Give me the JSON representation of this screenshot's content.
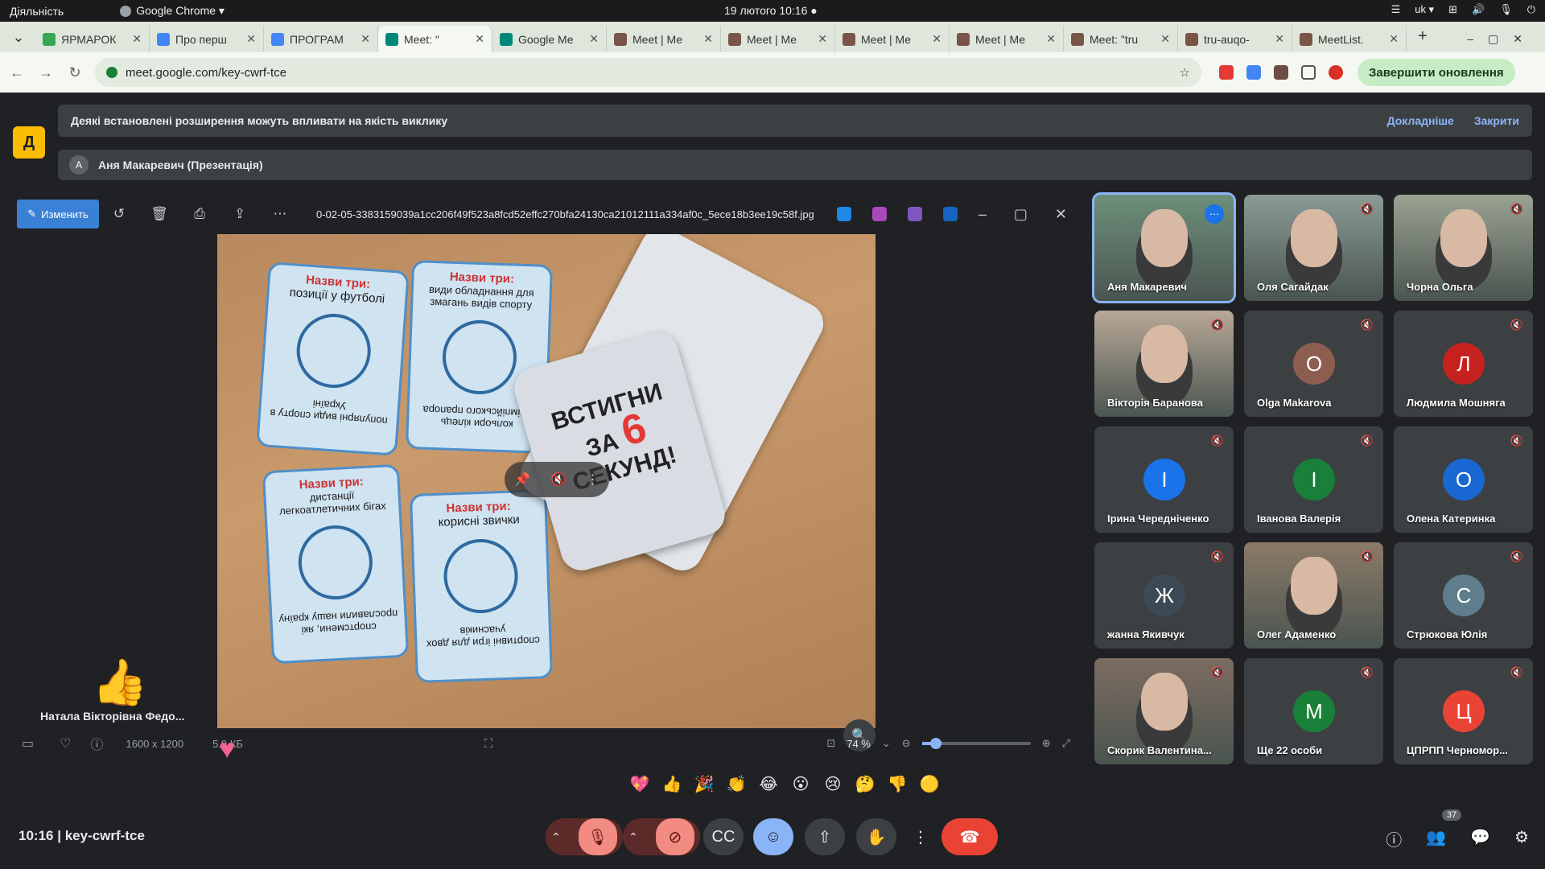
{
  "system": {
    "activities": "Діяльність",
    "browser": "Google Chrome ▾",
    "clock": "19 лютого  10:16  ●",
    "lang": "uk ▾"
  },
  "tabs": [
    {
      "label": "ЯРМАРОК",
      "color": "#34a853"
    },
    {
      "label": "Про перш",
      "color": "#4285f4"
    },
    {
      "label": "ПРОГРАМ",
      "color": "#4285f4"
    },
    {
      "label": "Meet: \"",
      "color": "#00897b"
    },
    {
      "label": "Google Me",
      "color": "#00897b"
    },
    {
      "label": "Meet | Me",
      "color": "#795548"
    },
    {
      "label": "Meet | Me",
      "color": "#795548"
    },
    {
      "label": "Meet | Me",
      "color": "#795548"
    },
    {
      "label": "Meet | Me",
      "color": "#795548"
    },
    {
      "label": "Meet: \"tru",
      "color": "#795548"
    },
    {
      "label": "tru-auqo-",
      "color": "#795548"
    },
    {
      "label": "MeetList.",
      "color": "#795548"
    }
  ],
  "omnibox": {
    "url": "meet.google.com/key-cwrf-tce",
    "update": "Завершити оновлення"
  },
  "banner": {
    "text": "Деякі встановлені розширення можуть впливати на якість виклику",
    "more": "Докладніше",
    "close": "Закрити"
  },
  "presenter": {
    "initial": "А",
    "text": "Аня Макаревич (Презентація)"
  },
  "yellow_icon": "Д",
  "viewer": {
    "edit": "Изменить",
    "filename": "0-02-05-3383159039a1cc206f49f523a8fcd52effc270bfa24130ca21012111a334af0c_5ece18b3ee19c58f.jpg",
    "dimensions": "1600 x 1200",
    "filesize": "5.9 КБ",
    "zoom": "74 %",
    "zoom_level": 0.13
  },
  "photo": {
    "cards": [
      {
        "title": "Назви три:",
        "text": "позиції у футболі",
        "bottom": "популярні види спорту в Україні"
      },
      {
        "title": "Назви три:",
        "text": "види обладнання для змагань видів спорту",
        "bottom": "кольори кілець олімпійського прапора"
      },
      {
        "title": "Назви три:",
        "text": "дистанції легкоатлетичних бігах",
        "bottom": "спортсмени, які прославили нашу країну"
      },
      {
        "title": "Назви три:",
        "text": "корисні звички",
        "bottom": "спортивні ігри для двох учасників"
      }
    ],
    "game_title": [
      "ВСТИГНИ",
      "ЗА",
      "6",
      "СЕКУНД!"
    ]
  },
  "reaction_user": "Натала Вікторівна Федо...",
  "participants": [
    {
      "name": "Аня Макаревич",
      "initial": "",
      "color": "#6d8f7a",
      "active": true
    },
    {
      "name": "Оля Сагайдак",
      "initial": "",
      "color": "#8a9a95"
    },
    {
      "name": "Чорна Ольга",
      "initial": "",
      "color": "#9aa391"
    },
    {
      "name": "Вікторія Баранова",
      "initial": "",
      "color": "#b8a898"
    },
    {
      "name": "Olga Makarova",
      "initial": "O",
      "color": "#8d5e4f"
    },
    {
      "name": "Людмила Мошняга",
      "initial": "Л",
      "color": "#c5221f"
    },
    {
      "name": "Ірина Чередніченко",
      "initial": "І",
      "color": "#1a73e8"
    },
    {
      "name": "Іванова Валерія",
      "initial": "І",
      "color": "#188038"
    },
    {
      "name": "Олена Катеринка",
      "initial": "О",
      "color": "#1967d2"
    },
    {
      "name": "жанна Якивчук",
      "initial": "Ж",
      "color": "#3c4a55"
    },
    {
      "name": "Олег Адаменко",
      "initial": "",
      "color": "#8c7a68"
    },
    {
      "name": "Стрюкова Юлія",
      "initial": "С",
      "color": "#5f7d8c"
    },
    {
      "name": "Скорик Валентина...",
      "initial": "",
      "color": "#7c6b60"
    },
    {
      "name": "Ще 22 особи",
      "initial": "М",
      "color": "#188038"
    },
    {
      "name": "ЦПРПП Черномор...",
      "initial": "Ц",
      "color": "#ea4335"
    }
  ],
  "reactions": [
    "💖",
    "👍",
    "🎉",
    "👏",
    "😂",
    "😮",
    "😢",
    "🤔",
    "👎",
    "🟡"
  ],
  "meeting": {
    "time": "10:16",
    "code": "key-cwrf-tce",
    "people_count": "37"
  }
}
